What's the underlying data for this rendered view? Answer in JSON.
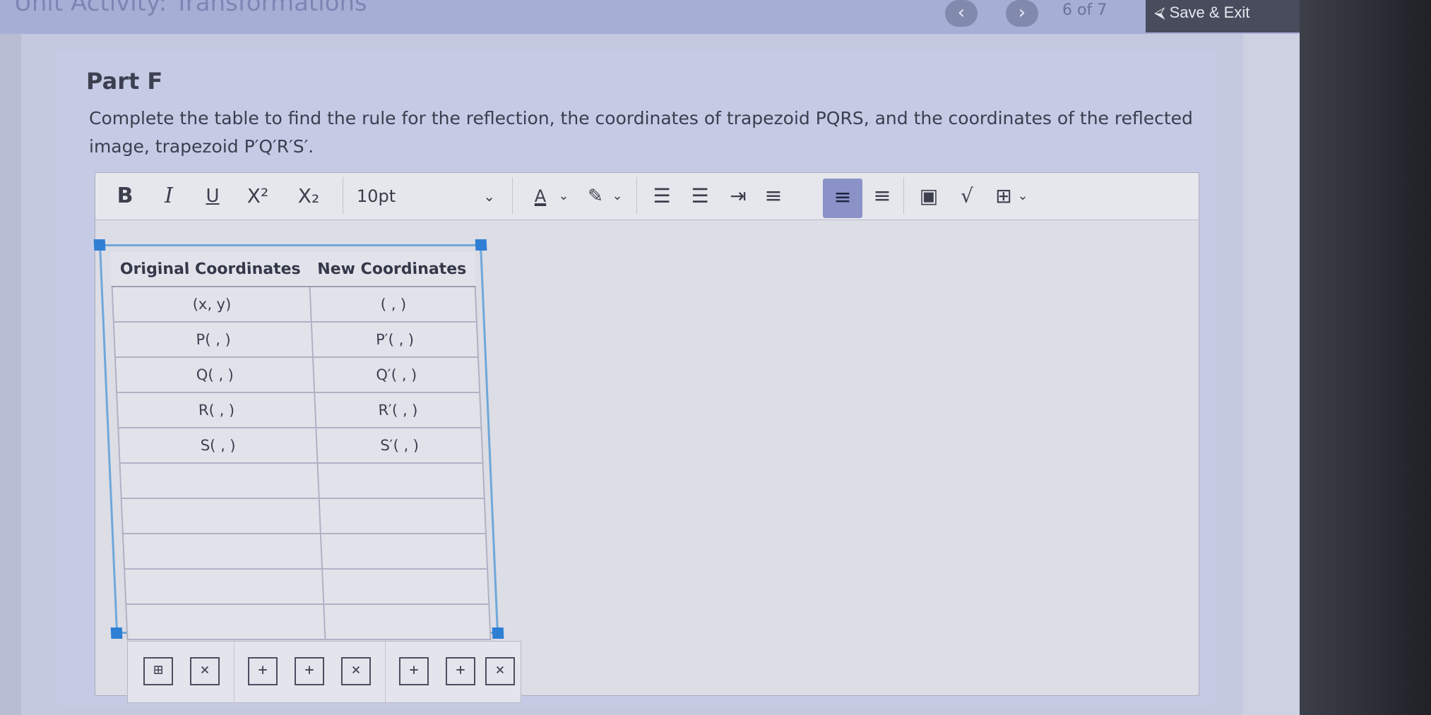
{
  "header": {
    "title": "Unit Activity: Transformations",
    "prev_icon": "chevron-left-icon",
    "next_icon": "chevron-right-icon",
    "prev_glyph": "‹",
    "next_glyph": "›",
    "page_counter": "6  of  7",
    "save_exit_label": "Save & Exit",
    "save_exit_glyph": "⮘"
  },
  "question": {
    "part_title": "Part F",
    "instructions": "Complete the table to find the rule for the reflection, the coordinates of trapezoid PQRS, and the coordinates of the reflected image, trapezoid P′Q′R′S′."
  },
  "toolbar": {
    "bold": "B",
    "italic": "I",
    "underline": "U",
    "superscript": "X²",
    "subscript": "X₂",
    "font_size": "10pt",
    "chevron": "⌄",
    "font_color": "A",
    "highlight": "✎",
    "bullet_list": "☰",
    "numbered_list": "☰",
    "indent": "⇥",
    "align_left": "≡",
    "align_center": "≡",
    "align_right": "≡",
    "image": "▣",
    "math": "√",
    "table": "⊞"
  },
  "table": {
    "headers": [
      "Original Coordinates",
      "New Coordinates"
    ],
    "rows": [
      [
        "(x, y)",
        "( , )"
      ],
      [
        "P( , )",
        "P′( , )"
      ],
      [
        "Q( , )",
        "Q′( , )"
      ],
      [
        "R( , )",
        "R′( , )"
      ],
      [
        "S( , )",
        "S′( , )"
      ],
      [
        "",
        ""
      ],
      [
        "",
        ""
      ],
      [
        "",
        ""
      ],
      [
        "",
        ""
      ],
      [
        "",
        ""
      ]
    ]
  },
  "table_tools": {
    "table_props": "⊞",
    "delete_table": "×",
    "insert_row_above": "+",
    "insert_row_below": "+",
    "delete_row": "×",
    "insert_col_left": "+",
    "insert_col_right": "+",
    "delete_col": "×"
  }
}
